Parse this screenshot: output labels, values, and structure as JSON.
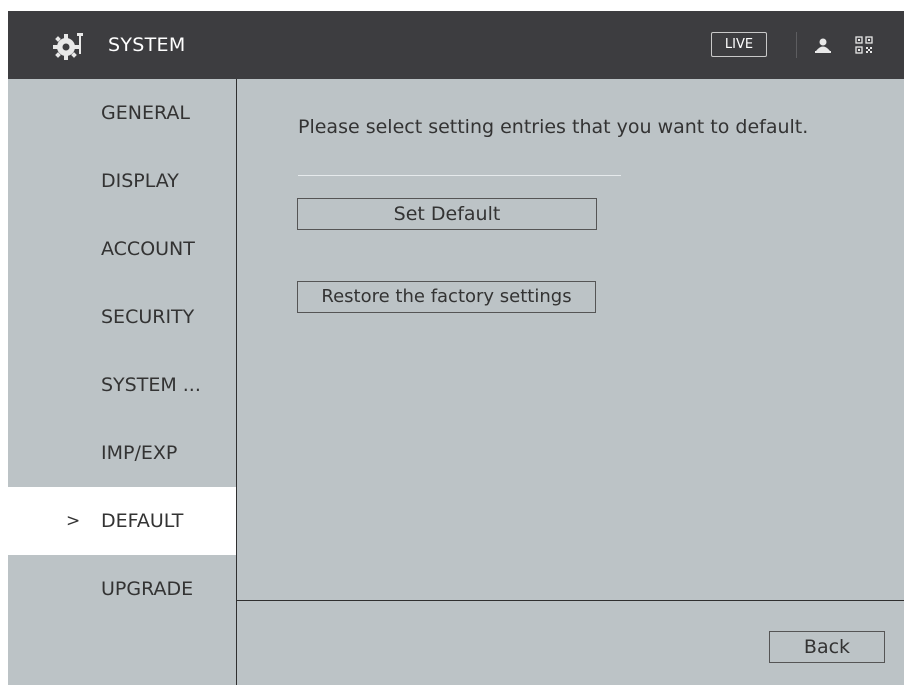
{
  "header": {
    "title": "SYSTEM",
    "live_label": "LIVE",
    "icons": [
      "settings-icon",
      "user-icon",
      "qr-code-icon"
    ]
  },
  "sidebar": {
    "items": [
      {
        "label": "GENERAL",
        "active": false
      },
      {
        "label": "DISPLAY",
        "active": false
      },
      {
        "label": "ACCOUNT",
        "active": false
      },
      {
        "label": "SECURITY",
        "active": false
      },
      {
        "label": "SYSTEM ...",
        "active": false
      },
      {
        "label": "IMP/EXP",
        "active": false
      },
      {
        "label": "DEFAULT",
        "active": true
      },
      {
        "label": "UPGRADE",
        "active": false
      }
    ],
    "active_marker": ">"
  },
  "content": {
    "prompt": "Please select setting entries that you want to default.",
    "set_default_label": "Set Default",
    "restore_label": "Restore the factory settings"
  },
  "footer": {
    "back_label": "Back"
  },
  "colors": {
    "header_bg": "#3d3d40",
    "panel_bg": "#bcc3c6",
    "active_bg": "#ffffff",
    "text": "#333333"
  }
}
